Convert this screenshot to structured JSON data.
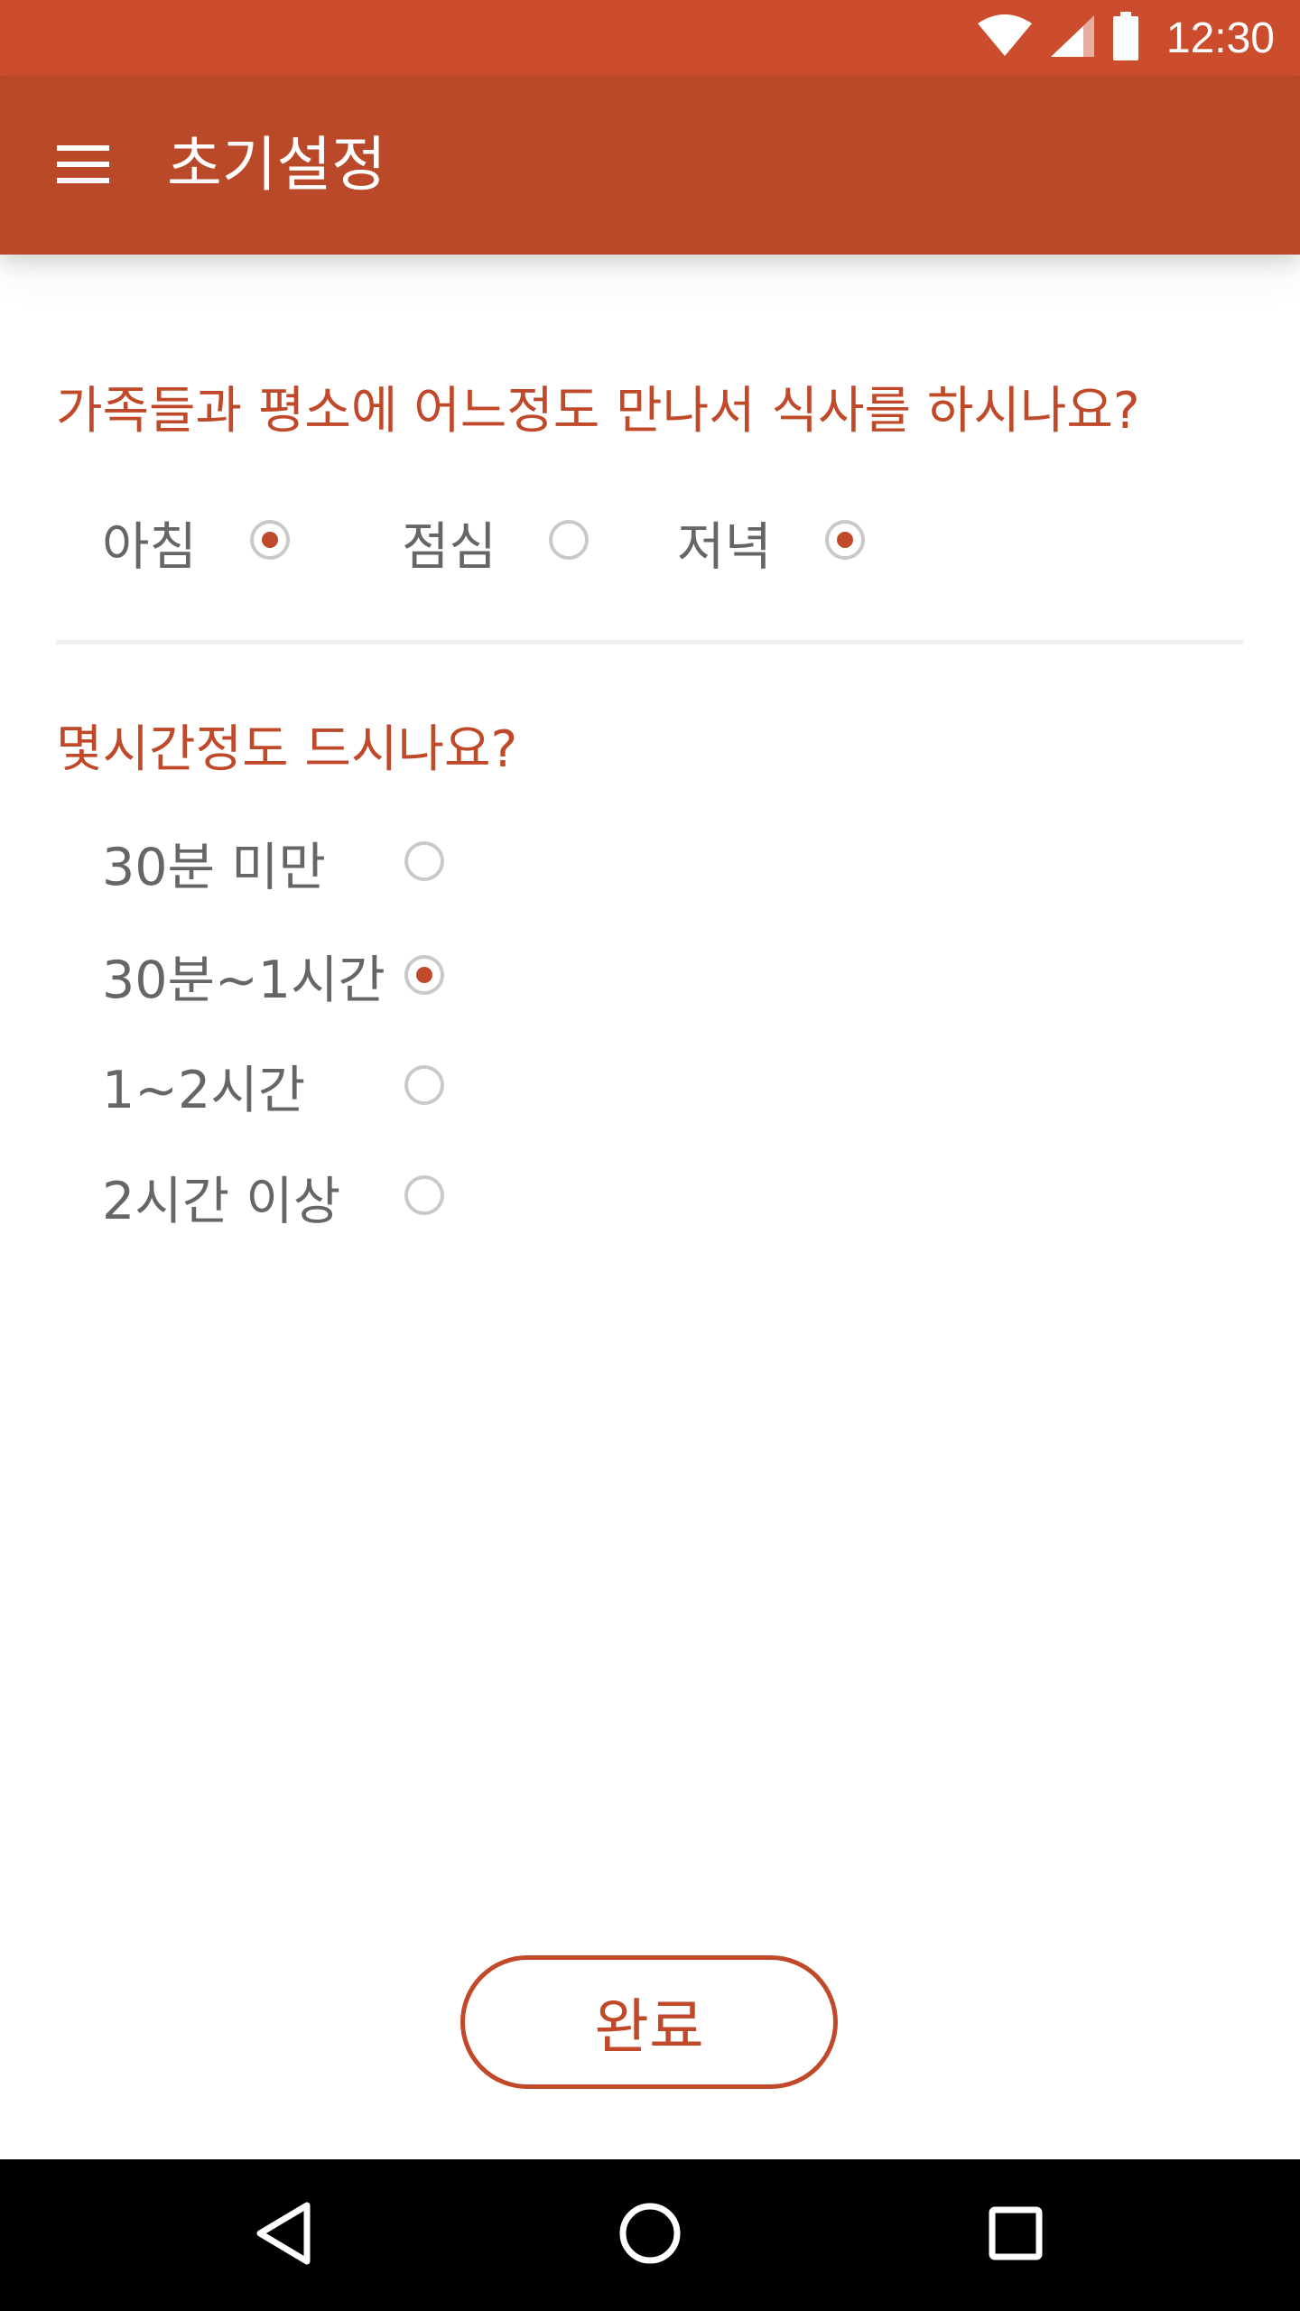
{
  "status_bar": {
    "time": "12:30",
    "icons": [
      "wifi-icon",
      "cell-signal-icon",
      "battery-icon"
    ]
  },
  "app_bar": {
    "title": "초기설정",
    "menu_icon": "menu-icon"
  },
  "question1": {
    "text": "가족들과 평소에 어느정도 만나서 식사를 하시나요?",
    "options": [
      {
        "label": "아침",
        "checked": true
      },
      {
        "label": "점심",
        "checked": false
      },
      {
        "label": "저녁",
        "checked": true
      }
    ]
  },
  "question2": {
    "text": "몇시간정도 드시나요?",
    "options": [
      {
        "label": "30분 미만",
        "checked": false
      },
      {
        "label": "30분~1시간",
        "checked": true
      },
      {
        "label": "1~2시간",
        "checked": false
      },
      {
        "label": "2시간 이상",
        "checked": false
      }
    ]
  },
  "done_button": {
    "label": "완료"
  },
  "nav_bar": {
    "icons": [
      "back-icon",
      "home-icon",
      "recents-icon"
    ]
  },
  "colors": {
    "status_bar": "#cb4d2d",
    "app_bar": "#b94929",
    "accent": "#c0492a",
    "radio_border": "#c9c9c9",
    "option_text": "#666666"
  }
}
